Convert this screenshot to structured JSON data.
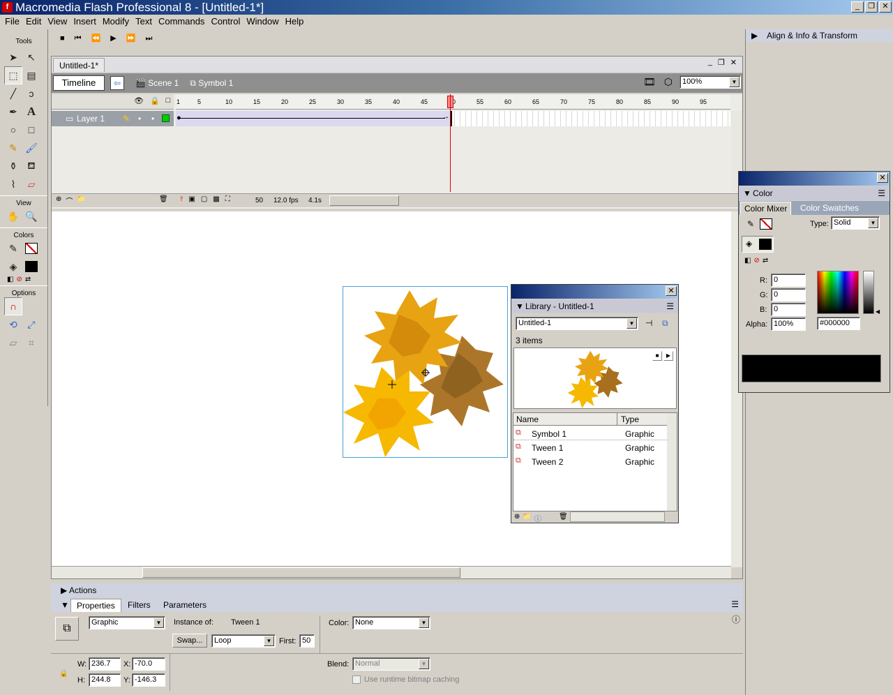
{
  "window": {
    "title": "Macromedia Flash Professional 8 - [Untitled-1*]"
  },
  "menu": [
    "File",
    "Edit",
    "View",
    "Insert",
    "Modify",
    "Text",
    "Commands",
    "Control",
    "Window",
    "Help"
  ],
  "tools": {
    "title": "Tools",
    "view_title": "View",
    "colors_title": "Colors",
    "options_title": "Options"
  },
  "document": {
    "tab": "Untitled-1*",
    "timeline_button": "Timeline",
    "scene": "Scene 1",
    "symbol": "Symbol 1",
    "zoom": "100%"
  },
  "timeline": {
    "layer_name": "Layer 1",
    "ruler": [
      "1",
      "5",
      "10",
      "15",
      "20",
      "25",
      "30",
      "35",
      "40",
      "45",
      "50",
      "55",
      "60",
      "65",
      "70",
      "75",
      "80",
      "85",
      "90",
      "95"
    ],
    "current_frame": "50",
    "fps": "12.0 fps",
    "time": "4.1s"
  },
  "library": {
    "title": "Library - Untitled-1",
    "doc_select": "Untitled-1",
    "count": "3 items",
    "col_name": "Name",
    "col_type": "Type",
    "items": [
      {
        "name": "Symbol 1",
        "type": "Graphic"
      },
      {
        "name": "Tween 1",
        "type": "Graphic"
      },
      {
        "name": "Tween 2",
        "type": "Graphic"
      }
    ]
  },
  "right_dock": {
    "align_header": "Align & Info & Transform"
  },
  "color_panel": {
    "title": "Color",
    "tab_mixer": "Color Mixer",
    "tab_swatches": "Color Swatches",
    "type_label": "Type:",
    "type_value": "Solid",
    "r_label": "R:",
    "r_value": "0",
    "g_label": "G:",
    "g_value": "0",
    "b_label": "B:",
    "b_value": "0",
    "alpha_label": "Alpha:",
    "alpha_value": "100%",
    "hex": "#000000",
    "swatch_color": "#000000"
  },
  "bottom_panels": {
    "actions": "Actions",
    "tab_properties": "Properties",
    "tab_filters": "Filters",
    "tab_parameters": "Parameters"
  },
  "properties": {
    "symbol_type": "Graphic",
    "instance_label": "Instance of:",
    "instance_value": "Tween 1",
    "swap_button": "Swap...",
    "loop_value": "Loop",
    "first_label": "First:",
    "first_value": "50",
    "color_label": "Color:",
    "color_value": "None",
    "w_label": "W:",
    "w_value": "236.7",
    "h_label": "H:",
    "h_value": "244.8",
    "x_label": "X:",
    "x_value": "-70.0",
    "y_label": "Y:",
    "y_value": "-146.3",
    "blend_label": "Blend:",
    "blend_value": "Normal",
    "bitmap_cache_label": "Use runtime bitmap caching"
  }
}
